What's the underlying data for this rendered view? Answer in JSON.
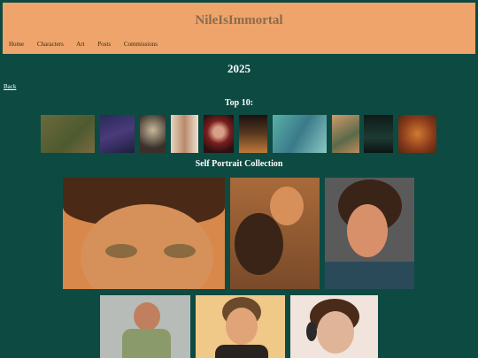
{
  "site": {
    "title": "NileIsImmortal"
  },
  "nav": {
    "items": [
      "Home",
      "Characters",
      "Art",
      "Posts",
      "Commissions"
    ]
  },
  "page": {
    "year": "2025",
    "back_label": "Back",
    "top10_title": "Top 10:",
    "collection_title": "Self Portrait Collection"
  },
  "colors": {
    "background": "#0d4a42",
    "header": "#eea46a",
    "title_text": "#8a6a4e"
  }
}
